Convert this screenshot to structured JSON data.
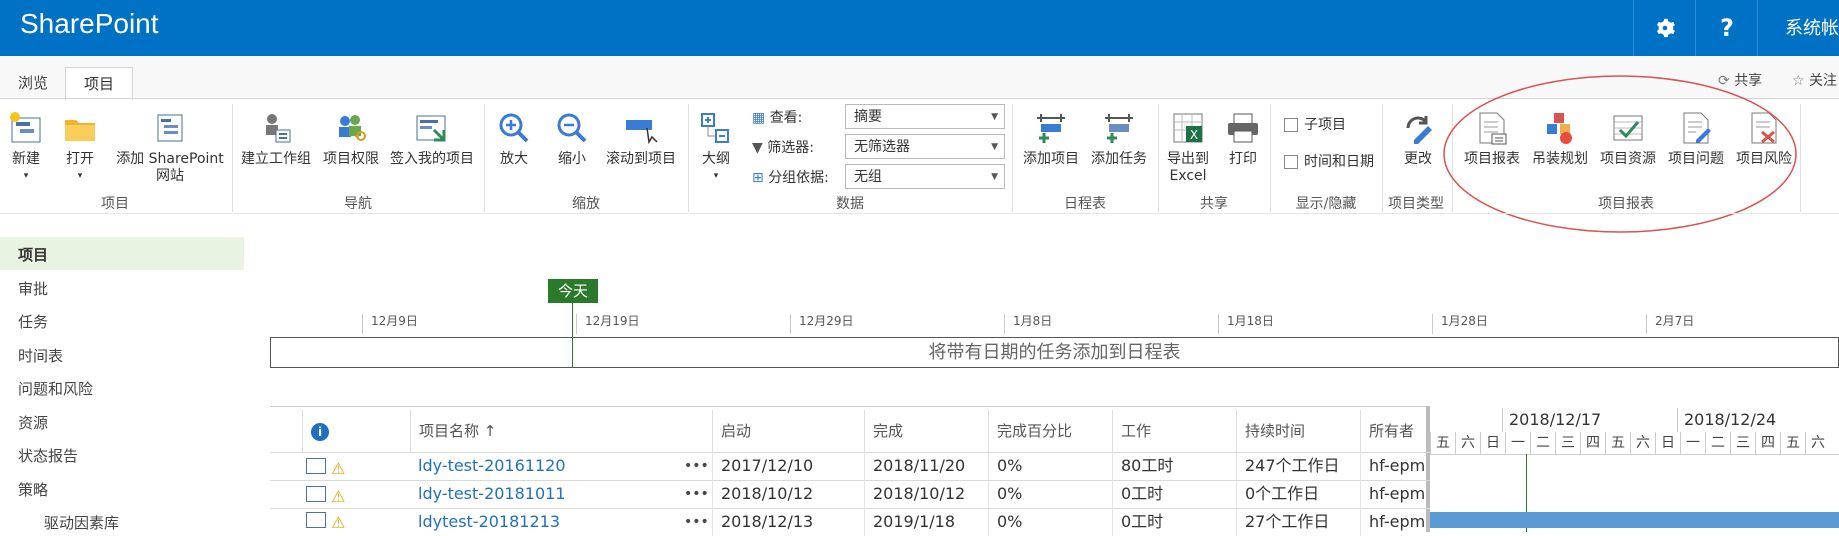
{
  "app": {
    "brand": "SharePoint",
    "account": "系统帐户"
  },
  "topbar": {
    "settings_icon": "gear-icon",
    "help_label": "?"
  },
  "tabs": [
    {
      "label": "浏览"
    },
    {
      "label": "项目"
    }
  ],
  "ribbon_top": {
    "share": "共享",
    "follow": "关注"
  },
  "ribbon": {
    "project": {
      "new": "新建",
      "open": "打开",
      "add_site_1": "添加 SharePoint",
      "add_site_2": "网站",
      "group": "项目"
    },
    "nav": {
      "build_team": "建立工作组",
      "permissions": "项目权限",
      "checkin": "签入我的项目",
      "group": "导航"
    },
    "zoom": {
      "zoom_in": "放大",
      "zoom_out": "缩小",
      "scroll": "滚动到项目",
      "group": "缩放"
    },
    "data": {
      "outline": "大纲",
      "view_label": "查看:",
      "view_value": "摘要",
      "filter_label": "筛选器:",
      "filter_value": "无筛选器",
      "groupby_label": "分组依据:",
      "groupby_value": "无组",
      "group": "数据"
    },
    "schedule": {
      "add_project": "添加项目",
      "add_task": "添加任务",
      "group": "日程表"
    },
    "share": {
      "export_1": "导出到",
      "export_2": "Excel",
      "print": "打印",
      "group": "共享"
    },
    "show_hide": {
      "subproject": "子项目",
      "time_date": "时间和日期",
      "group": "显示/隐藏"
    },
    "project_type": {
      "change": "更改",
      "group": "项目类型"
    },
    "reports": {
      "report": "项目报表",
      "install_plan": "吊装规划",
      "resources": "项目资源",
      "issues": "项目问题",
      "risks": "项目风险",
      "group": "项目报表"
    }
  },
  "left_nav": [
    {
      "label": "项目"
    },
    {
      "label": "审批"
    },
    {
      "label": "任务"
    },
    {
      "label": "时间表"
    },
    {
      "label": "问题和风险"
    },
    {
      "label": "资源"
    },
    {
      "label": "状态报告"
    },
    {
      "label": "策略"
    },
    {
      "label": "驱动因素库"
    }
  ],
  "timeline": {
    "today": "今天",
    "ticks": [
      "12月9日",
      "12月19日",
      "12月29日",
      "1月8日",
      "1月18日",
      "1月28日",
      "2月7日"
    ],
    "placeholder": "将带有日期的任务添加到日程表"
  },
  "grid": {
    "columns": {
      "name": "项目名称 ↑",
      "start": "启动",
      "finish": "完成",
      "percent": "完成百分比",
      "work": "工作",
      "duration": "持续时间",
      "owner": "所有者"
    },
    "rows": [
      {
        "name": "ldy-test-20161120",
        "start": "2017/12/10",
        "finish": "2018/11/20",
        "percent": "0%",
        "work": "80工时",
        "duration": "247个工作日",
        "owner": "hf-epm"
      },
      {
        "name": "ldy-test-20181011",
        "start": "2018/10/12",
        "finish": "2018/10/12",
        "percent": "0%",
        "work": "0工时",
        "duration": "0个工作日",
        "owner": "hf-epm"
      },
      {
        "name": "ldytest-20181213",
        "start": "2018/12/13",
        "finish": "2019/1/18",
        "percent": "0%",
        "work": "0工时",
        "duration": "27个工作日",
        "owner": "hf-epm"
      }
    ],
    "more": "•••"
  },
  "gantt": {
    "weeks": [
      "2018/12/17",
      "2018/12/24"
    ],
    "days": [
      "五",
      "六",
      "日",
      "一",
      "二",
      "三",
      "四",
      "五",
      "六",
      "日",
      "一",
      "二",
      "三",
      "四",
      "五",
      "六"
    ]
  }
}
